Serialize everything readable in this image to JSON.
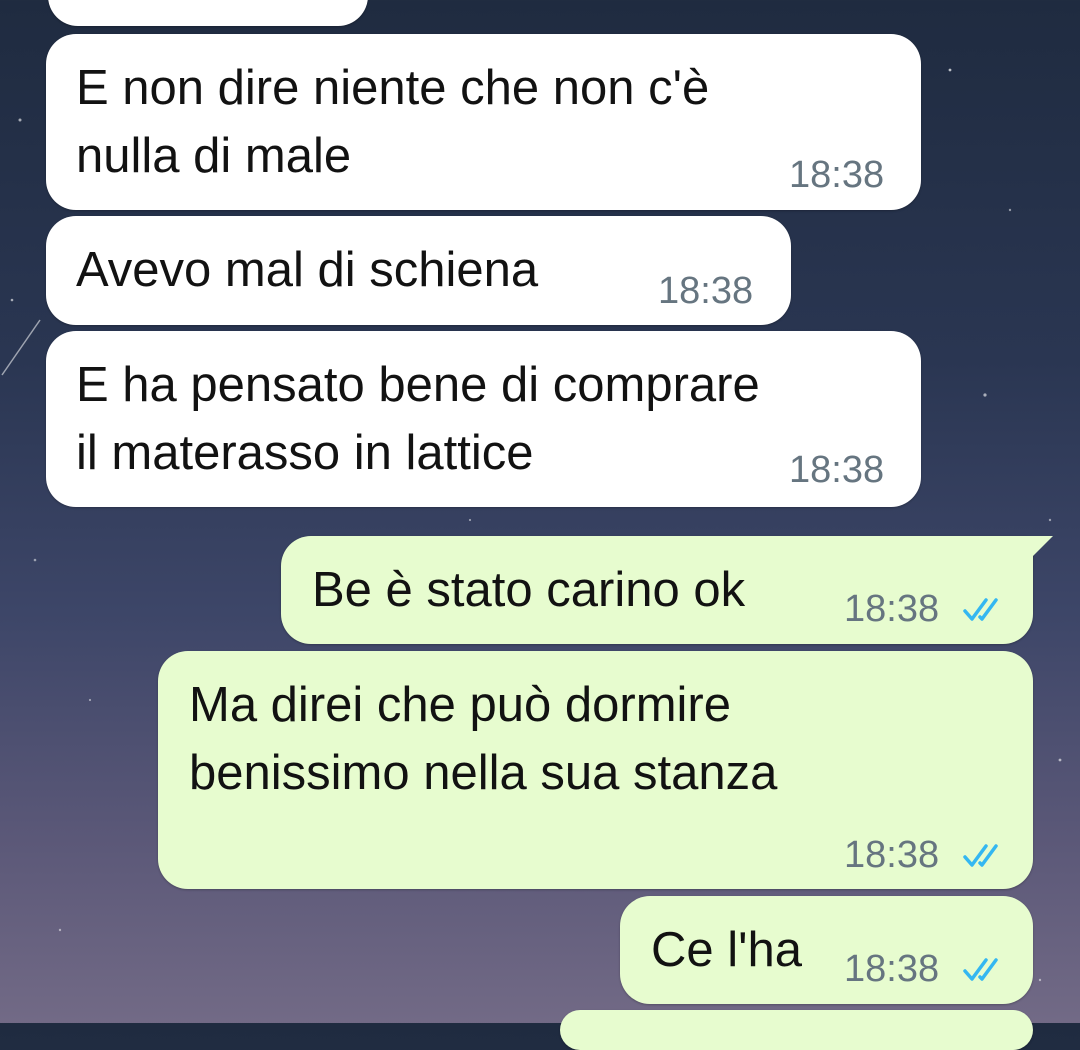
{
  "colors": {
    "incoming_bubble": "#ffffff",
    "outgoing_bubble": "#e7fccf",
    "read_ticks": "#34b7f1"
  },
  "messages": [
    {
      "direction": "incoming",
      "lines": [
        "E non dire niente che non c'è",
        "nulla di male"
      ],
      "time": "18:38"
    },
    {
      "direction": "incoming",
      "lines": [
        "Avevo mal di schiena"
      ],
      "time": "18:38"
    },
    {
      "direction": "incoming",
      "lines": [
        "E ha pensato bene di comprare",
        "il materasso in lattice"
      ],
      "time": "18:38"
    },
    {
      "direction": "outgoing",
      "lines": [
        "Be è stato carino ok"
      ],
      "time": "18:38",
      "status_icon": "double-check-read-icon"
    },
    {
      "direction": "outgoing",
      "lines": [
        "Ma direi che può dormire",
        "benissimo nella sua stanza"
      ],
      "time": "18:38",
      "status_icon": "double-check-read-icon"
    },
    {
      "direction": "outgoing",
      "lines": [
        "Ce l'ha"
      ],
      "time": "18:38",
      "status_icon": "double-check-read-icon"
    }
  ]
}
